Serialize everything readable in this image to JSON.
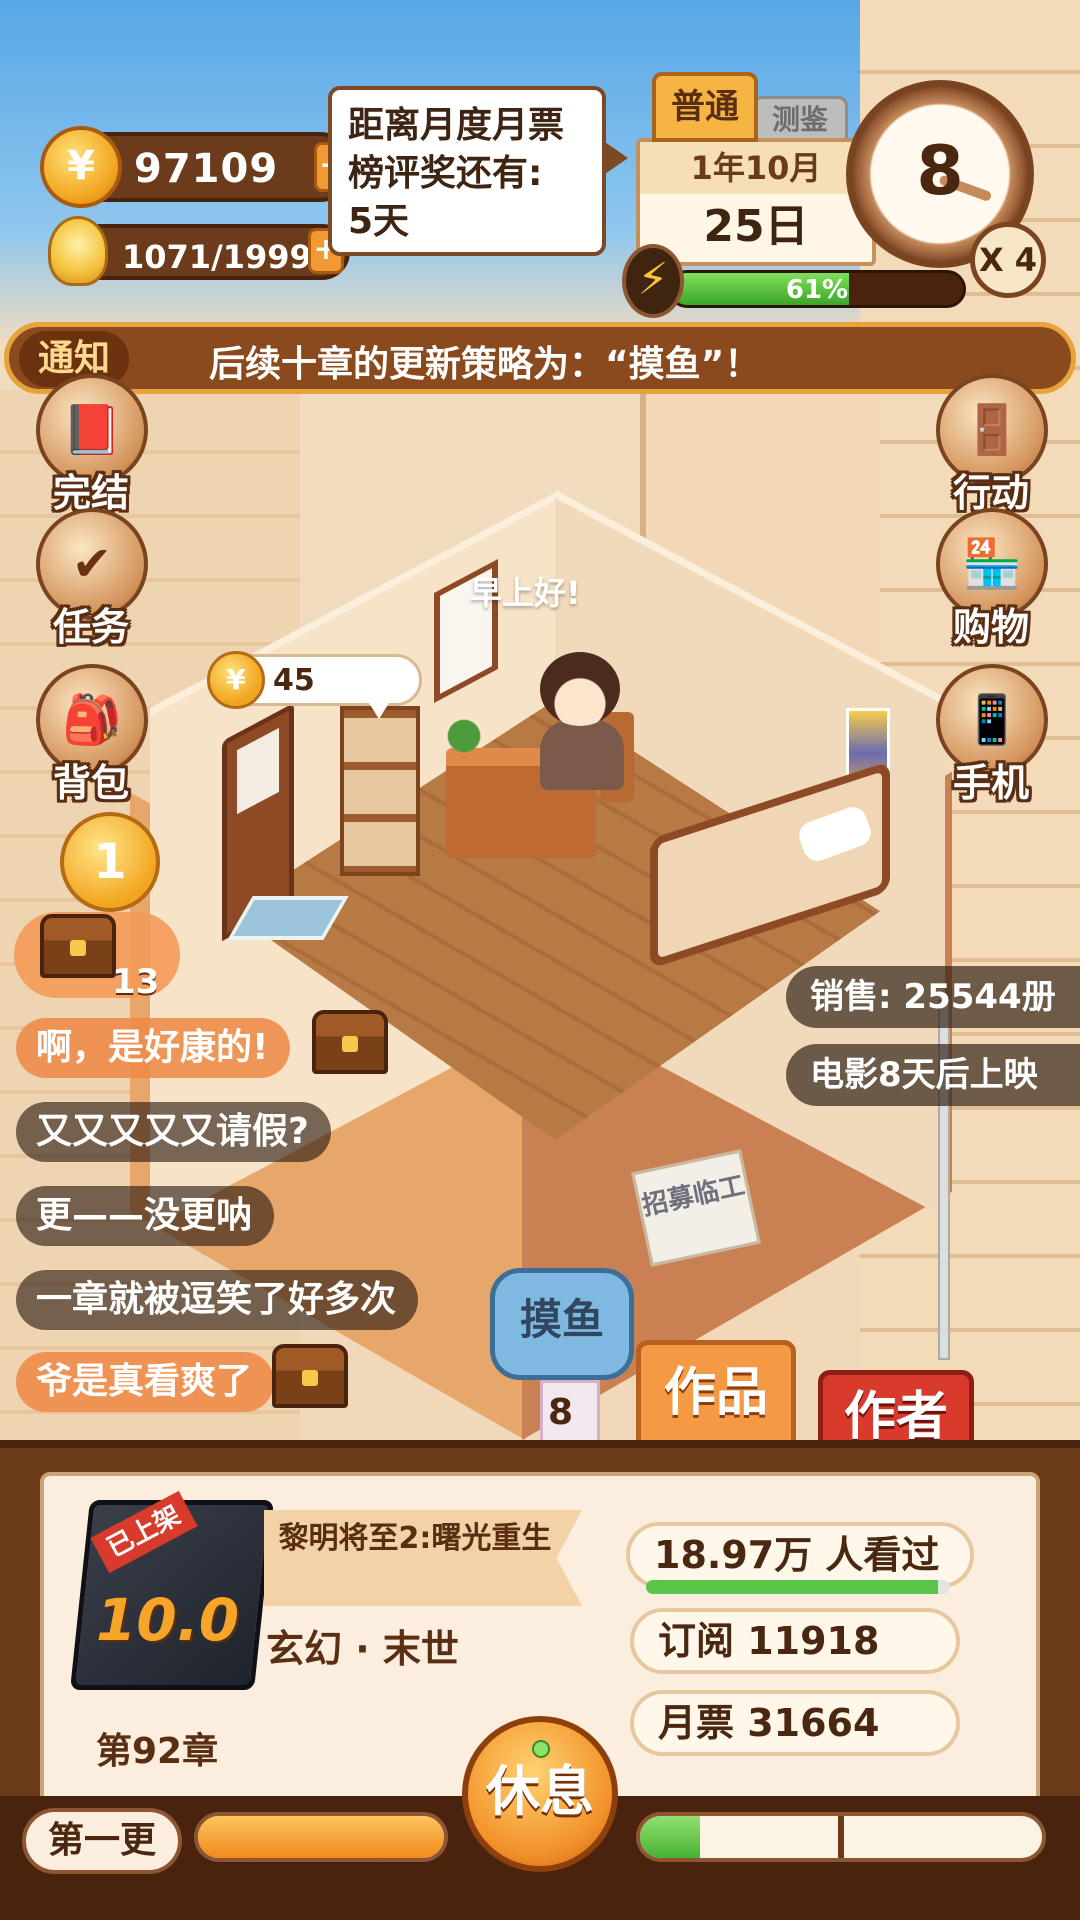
{
  "hud": {
    "coins": "97109",
    "coin_symbol": "¥",
    "ideas": "1071/1999",
    "plus": "+"
  },
  "tooltip": {
    "lines": [
      "距离月度月票",
      "榜评奖还有:",
      "5天"
    ]
  },
  "calendar": {
    "tab_active": "普通",
    "tab_inactive": "测鉴",
    "month": "1年10月",
    "day": "25日"
  },
  "clock": {
    "hour": "8",
    "multiplier": "X 4"
  },
  "energy": {
    "percent_label": "61%",
    "percent": 61
  },
  "notice": {
    "label": "通知",
    "text": "后续十章的更新策略为：“摸鱼”！"
  },
  "side_left": [
    {
      "label": "完结",
      "icon": "book-icon"
    },
    {
      "label": "任务",
      "icon": "checklist-icon"
    },
    {
      "label": "背包",
      "icon": "backpack-icon"
    }
  ],
  "side_right": [
    {
      "label": "行动",
      "icon": "door-icon"
    },
    {
      "label": "购物",
      "icon": "shop-icon"
    },
    {
      "label": "手机",
      "icon": "phone-icon"
    }
  ],
  "rank": {
    "medal_number": "1",
    "chest_count": "13"
  },
  "comments": [
    {
      "text": "啊，是好康的!"
    },
    {
      "text": "又又又又又请假?"
    },
    {
      "text": "更——没更呐"
    },
    {
      "text": "一章就被逗笑了好多次"
    },
    {
      "text": "爷是真看爽了"
    }
  ],
  "room": {
    "greeting": "早上好!",
    "coin_bubble_value": "45",
    "recruit_sign": "招募临工"
  },
  "info": {
    "sales": "销售: 25544册",
    "movie": "电影8天后上映"
  },
  "actions": {
    "slack_label": "摸鱼",
    "slack_count": "8",
    "works_label": "作品",
    "author_label": "作者"
  },
  "book": {
    "tag": "已上架",
    "score": "10.0",
    "title": "黎明将至2:曙光重生",
    "genre": "玄幻 · 末世",
    "chapter": "第92章"
  },
  "stats": {
    "views": "18.97万 人看过",
    "views_progress": 0.96,
    "subscriptions": "订阅  11918",
    "monthly_votes": "月票  31664"
  },
  "bottom": {
    "update_label": "第一更",
    "left_progress": 1.0,
    "right_progress": 0.15,
    "rest_label": "休息"
  }
}
